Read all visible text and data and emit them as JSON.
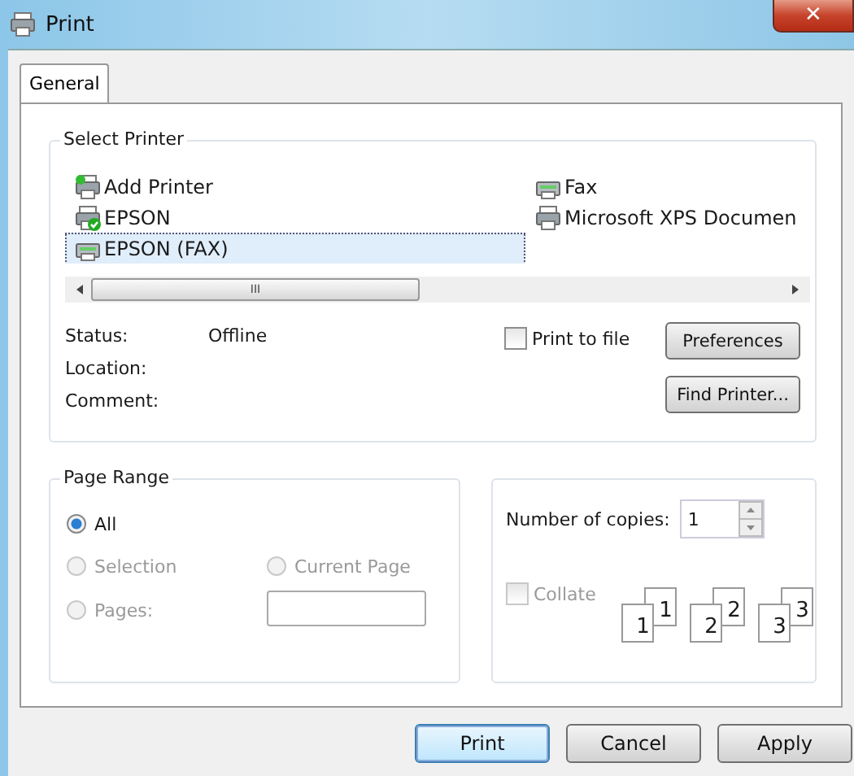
{
  "window": {
    "title": "Print",
    "close": "✕"
  },
  "tabs": [
    {
      "label": "General",
      "selected": true
    }
  ],
  "select_printer": {
    "title": "Select Printer",
    "printers": [
      {
        "name": "Add Printer",
        "kind": "add",
        "selected": false
      },
      {
        "name": "EPSON",
        "kind": "default",
        "selected": false
      },
      {
        "name": "EPSON  (FAX)",
        "kind": "fax",
        "selected": true
      },
      {
        "name": "Fax",
        "kind": "fax",
        "selected": false
      },
      {
        "name": "Microsoft XPS Documen",
        "kind": "printer",
        "selected": false
      }
    ],
    "scroll_grip": "III",
    "info": [
      {
        "label": "Status:",
        "value": "Offline"
      },
      {
        "label": "Location:"
      },
      {
        "label": "Comment:"
      }
    ],
    "print_to_file": {
      "label": "Print to file",
      "checked": false
    },
    "buttons": [
      "Preferences",
      "Find Printer..."
    ]
  },
  "page_range": {
    "title": "Page Range",
    "options": [
      {
        "label": "All",
        "selected": true,
        "disabled": false
      },
      {
        "label": "Selection",
        "selected": false,
        "disabled": true
      },
      {
        "label": "Current Page",
        "selected": false,
        "disabled": true
      },
      {
        "label": "Pages:",
        "selected": false,
        "disabled": true
      }
    ]
  },
  "copies": {
    "label": "Number of copies:",
    "value": "1",
    "collate": {
      "label": "Collate",
      "checked": false,
      "disabled": true
    },
    "collate_pages": [
      {
        "front": "1",
        "back": "1"
      },
      {
        "front": "2",
        "back": "2"
      },
      {
        "front": "3",
        "back": "3"
      }
    ]
  },
  "buttons": [
    {
      "label": "Print",
      "default": true
    },
    {
      "label": "Cancel",
      "default": false
    },
    {
      "label": "Apply",
      "default": false
    }
  ]
}
